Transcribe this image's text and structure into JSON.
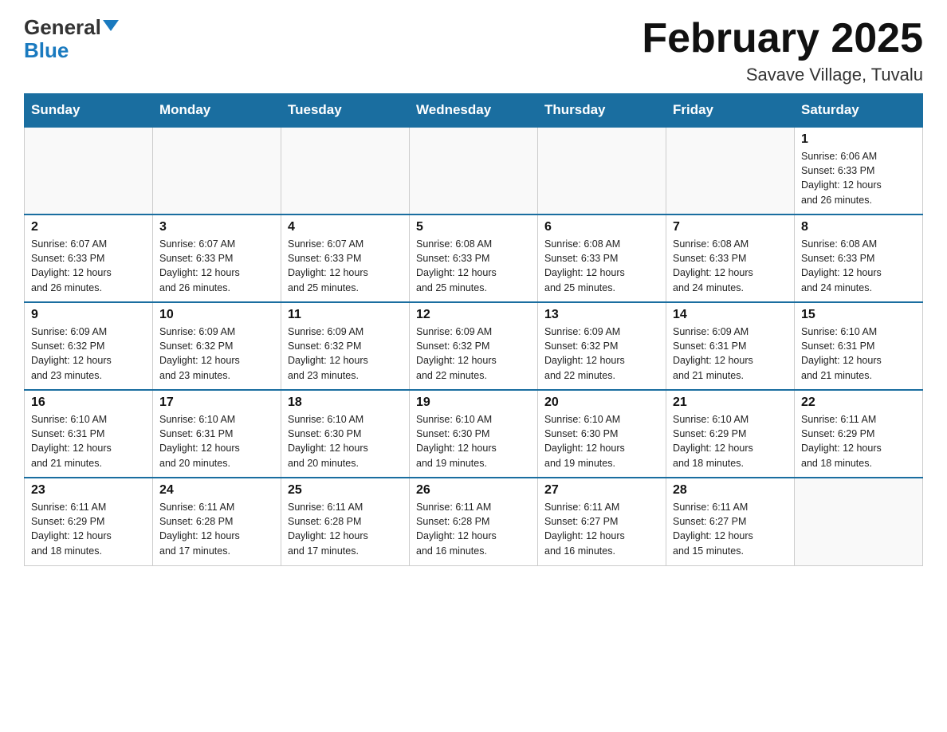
{
  "header": {
    "logo_general": "General",
    "logo_blue": "Blue",
    "title": "February 2025",
    "subtitle": "Savave Village, Tuvalu"
  },
  "days_of_week": [
    "Sunday",
    "Monday",
    "Tuesday",
    "Wednesday",
    "Thursday",
    "Friday",
    "Saturday"
  ],
  "weeks": [
    [
      {
        "day": "",
        "info": ""
      },
      {
        "day": "",
        "info": ""
      },
      {
        "day": "",
        "info": ""
      },
      {
        "day": "",
        "info": ""
      },
      {
        "day": "",
        "info": ""
      },
      {
        "day": "",
        "info": ""
      },
      {
        "day": "1",
        "info": "Sunrise: 6:06 AM\nSunset: 6:33 PM\nDaylight: 12 hours\nand 26 minutes."
      }
    ],
    [
      {
        "day": "2",
        "info": "Sunrise: 6:07 AM\nSunset: 6:33 PM\nDaylight: 12 hours\nand 26 minutes."
      },
      {
        "day": "3",
        "info": "Sunrise: 6:07 AM\nSunset: 6:33 PM\nDaylight: 12 hours\nand 26 minutes."
      },
      {
        "day": "4",
        "info": "Sunrise: 6:07 AM\nSunset: 6:33 PM\nDaylight: 12 hours\nand 25 minutes."
      },
      {
        "day": "5",
        "info": "Sunrise: 6:08 AM\nSunset: 6:33 PM\nDaylight: 12 hours\nand 25 minutes."
      },
      {
        "day": "6",
        "info": "Sunrise: 6:08 AM\nSunset: 6:33 PM\nDaylight: 12 hours\nand 25 minutes."
      },
      {
        "day": "7",
        "info": "Sunrise: 6:08 AM\nSunset: 6:33 PM\nDaylight: 12 hours\nand 24 minutes."
      },
      {
        "day": "8",
        "info": "Sunrise: 6:08 AM\nSunset: 6:33 PM\nDaylight: 12 hours\nand 24 minutes."
      }
    ],
    [
      {
        "day": "9",
        "info": "Sunrise: 6:09 AM\nSunset: 6:32 PM\nDaylight: 12 hours\nand 23 minutes."
      },
      {
        "day": "10",
        "info": "Sunrise: 6:09 AM\nSunset: 6:32 PM\nDaylight: 12 hours\nand 23 minutes."
      },
      {
        "day": "11",
        "info": "Sunrise: 6:09 AM\nSunset: 6:32 PM\nDaylight: 12 hours\nand 23 minutes."
      },
      {
        "day": "12",
        "info": "Sunrise: 6:09 AM\nSunset: 6:32 PM\nDaylight: 12 hours\nand 22 minutes."
      },
      {
        "day": "13",
        "info": "Sunrise: 6:09 AM\nSunset: 6:32 PM\nDaylight: 12 hours\nand 22 minutes."
      },
      {
        "day": "14",
        "info": "Sunrise: 6:09 AM\nSunset: 6:31 PM\nDaylight: 12 hours\nand 21 minutes."
      },
      {
        "day": "15",
        "info": "Sunrise: 6:10 AM\nSunset: 6:31 PM\nDaylight: 12 hours\nand 21 minutes."
      }
    ],
    [
      {
        "day": "16",
        "info": "Sunrise: 6:10 AM\nSunset: 6:31 PM\nDaylight: 12 hours\nand 21 minutes."
      },
      {
        "day": "17",
        "info": "Sunrise: 6:10 AM\nSunset: 6:31 PM\nDaylight: 12 hours\nand 20 minutes."
      },
      {
        "day": "18",
        "info": "Sunrise: 6:10 AM\nSunset: 6:30 PM\nDaylight: 12 hours\nand 20 minutes."
      },
      {
        "day": "19",
        "info": "Sunrise: 6:10 AM\nSunset: 6:30 PM\nDaylight: 12 hours\nand 19 minutes."
      },
      {
        "day": "20",
        "info": "Sunrise: 6:10 AM\nSunset: 6:30 PM\nDaylight: 12 hours\nand 19 minutes."
      },
      {
        "day": "21",
        "info": "Sunrise: 6:10 AM\nSunset: 6:29 PM\nDaylight: 12 hours\nand 18 minutes."
      },
      {
        "day": "22",
        "info": "Sunrise: 6:11 AM\nSunset: 6:29 PM\nDaylight: 12 hours\nand 18 minutes."
      }
    ],
    [
      {
        "day": "23",
        "info": "Sunrise: 6:11 AM\nSunset: 6:29 PM\nDaylight: 12 hours\nand 18 minutes."
      },
      {
        "day": "24",
        "info": "Sunrise: 6:11 AM\nSunset: 6:28 PM\nDaylight: 12 hours\nand 17 minutes."
      },
      {
        "day": "25",
        "info": "Sunrise: 6:11 AM\nSunset: 6:28 PM\nDaylight: 12 hours\nand 17 minutes."
      },
      {
        "day": "26",
        "info": "Sunrise: 6:11 AM\nSunset: 6:28 PM\nDaylight: 12 hours\nand 16 minutes."
      },
      {
        "day": "27",
        "info": "Sunrise: 6:11 AM\nSunset: 6:27 PM\nDaylight: 12 hours\nand 16 minutes."
      },
      {
        "day": "28",
        "info": "Sunrise: 6:11 AM\nSunset: 6:27 PM\nDaylight: 12 hours\nand 15 minutes."
      },
      {
        "day": "",
        "info": ""
      }
    ]
  ]
}
